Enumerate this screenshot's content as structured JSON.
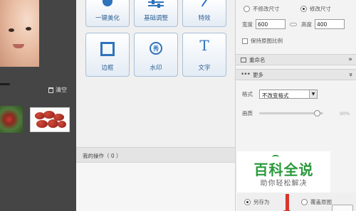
{
  "history": {
    "clear_label": "清空"
  },
  "tools": [
    {
      "label": "一键美化",
      "icon": "flower-icon"
    },
    {
      "label": "基础调整",
      "icon": "sliders-icon"
    },
    {
      "label": "特效",
      "icon": "magic-wand-icon"
    },
    {
      "label": "边框",
      "icon": "frame-icon"
    },
    {
      "label": "水印",
      "icon": "seal-icon",
      "icon_text": "秀"
    },
    {
      "label": "文字",
      "icon": "text-icon",
      "icon_text": "T"
    }
  ],
  "operations": {
    "label": "我的操作（ 0 ）"
  },
  "size": {
    "option_keep": "不修改尺寸",
    "option_modify": "修改尺寸",
    "selected": "修改尺寸",
    "width_label": "宽度",
    "width_value": "600",
    "height_label": "高度",
    "height_value": "400",
    "keep_ratio_label": "保持原图比例"
  },
  "rename": {
    "label": "重命名",
    "chevron": "»"
  },
  "more": {
    "label": "更多",
    "chevron": "»",
    "format_label": "格式",
    "format_value": "不改变格式",
    "quality_label": "画质",
    "quality_value": "90%",
    "quality_fraction": 0.9
  },
  "watermark": {
    "title": "百科全说",
    "subtitle": "助你轻松解决"
  },
  "save": {
    "option_save_as": "另存为",
    "option_overwrite": "覆盖原图",
    "selected": "另存为"
  },
  "colors": {
    "accent": "#2f73bb",
    "watermark_green": "#2a9a3c",
    "arrow_red": "#d9352b"
  }
}
